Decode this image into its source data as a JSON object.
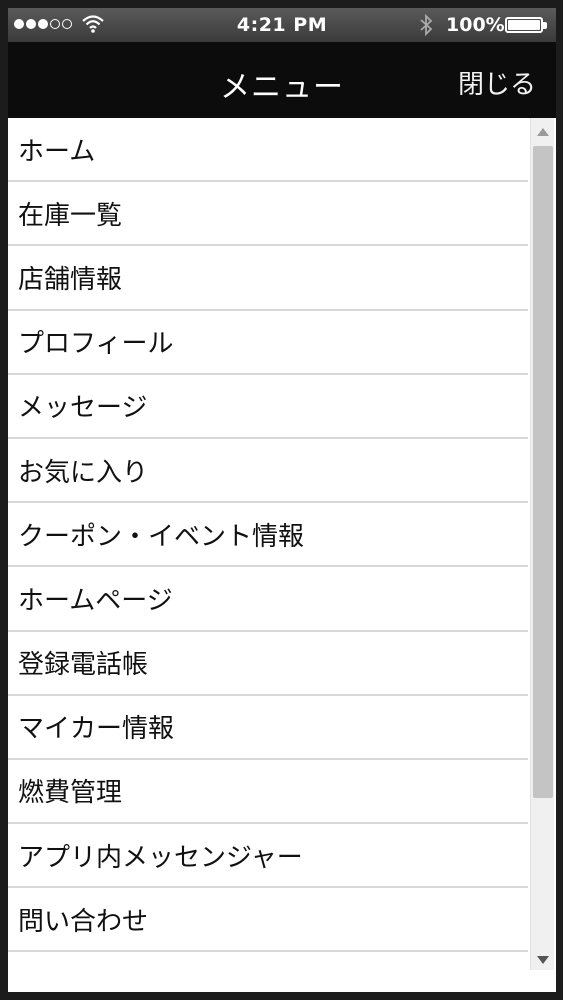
{
  "status_bar": {
    "time": "4:21 PM",
    "battery_percent": "100%",
    "signal_bars_on": 3,
    "signal_bars_total": 5,
    "icons": [
      "signal-icon",
      "wifi-icon",
      "bluetooth-icon",
      "battery-icon"
    ]
  },
  "nav": {
    "title": "メニュー",
    "close_label": "閉じる"
  },
  "menu": {
    "items": [
      {
        "label": "ホーム"
      },
      {
        "label": "在庫一覧"
      },
      {
        "label": "店舗情報"
      },
      {
        "label": "プロフィール"
      },
      {
        "label": "メッセージ"
      },
      {
        "label": "お気に入り"
      },
      {
        "label": "クーポン・イベント情報"
      },
      {
        "label": "ホームページ"
      },
      {
        "label": "登録電話帳"
      },
      {
        "label": "マイカー情報"
      },
      {
        "label": "燃費管理"
      },
      {
        "label": "アプリ内メッセンジャー"
      },
      {
        "label": "問い合わせ"
      }
    ]
  },
  "colors": {
    "status_bar_bg": "#4a4a4a",
    "nav_bg": "#0c0c0c",
    "list_bg": "#ffffff",
    "divider": "#d8d8d8",
    "scroll_thumb": "#c4c4c4"
  }
}
